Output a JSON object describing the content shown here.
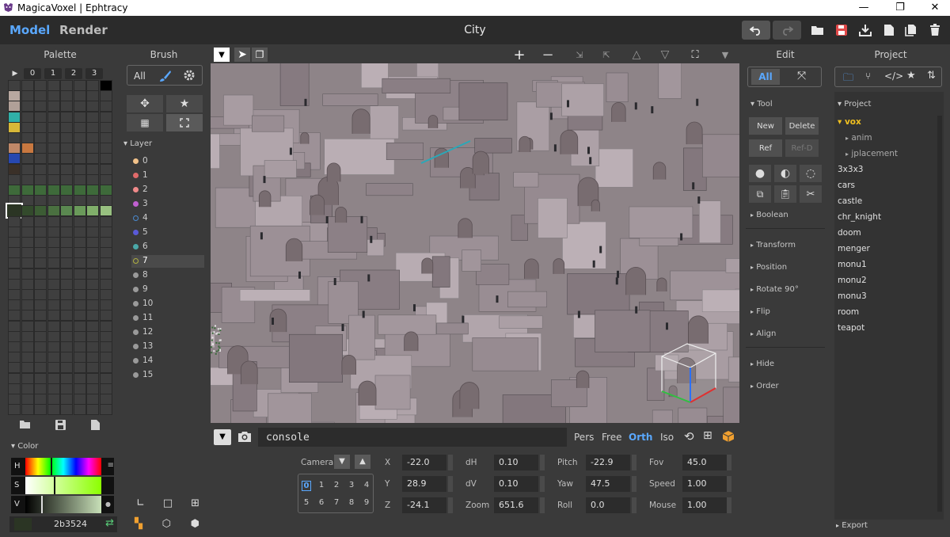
{
  "window": {
    "title": "MagicaVoxel | Ephtracy",
    "controls": [
      "—",
      "❐",
      "✕"
    ]
  },
  "header": {
    "tabs": [
      {
        "label": "Model"
      },
      {
        "label": "Render"
      }
    ],
    "doc_title": "City"
  },
  "palette": {
    "title": "Palette",
    "tabs": [
      "0",
      "1",
      "2",
      "3"
    ],
    "play_symbol": "▶",
    "accent": "#ffffff"
  },
  "color": {
    "title": "Color",
    "h_label": "H",
    "s_label": "S",
    "v_label": "V",
    "hex": "2b3524",
    "swatch_color": "#2b3524"
  },
  "brush": {
    "title": "Brush",
    "all_label": "All",
    "layer_title": "Layer",
    "layers": [
      {
        "label": "0",
        "color": "#f2c28a"
      },
      {
        "label": "1",
        "color": "#e06a6a"
      },
      {
        "label": "2",
        "color": "#f08a8a"
      },
      {
        "label": "3",
        "color": "#c060d0"
      },
      {
        "label": "4",
        "color": "#4a8ad0"
      },
      {
        "label": "5",
        "color": "#5a5ad8"
      },
      {
        "label": "6",
        "color": "#4aa8a8"
      },
      {
        "label": "7",
        "color": "#b0b040"
      },
      {
        "label": "8",
        "color": "#9a9a9a"
      },
      {
        "label": "9",
        "color": "#9a9a9a"
      },
      {
        "label": "10",
        "color": "#9a9a9a"
      },
      {
        "label": "11",
        "color": "#9a9a9a"
      },
      {
        "label": "12",
        "color": "#9a9a9a"
      },
      {
        "label": "13",
        "color": "#9a9a9a"
      },
      {
        "label": "14",
        "color": "#9a9a9a"
      },
      {
        "label": "15",
        "color": "#9a9a9a"
      }
    ]
  },
  "console": {
    "value": "console",
    "modes": [
      "Pers",
      "Free",
      "Orth",
      "Iso"
    ],
    "active_mode": "Orth"
  },
  "camera": {
    "label": "Camera",
    "slots": [
      "0",
      "1",
      "2",
      "3",
      "4",
      "5",
      "6",
      "7",
      "8",
      "9"
    ],
    "fields": {
      "x_label": "X",
      "x": "-22.0",
      "y_label": "Y",
      "y": "28.9",
      "z_label": "Z",
      "z": "-24.1",
      "dh_label": "dH",
      "dh": "0.10",
      "dv_label": "dV",
      "dv": "0.10",
      "zoom_label": "Zoom",
      "zoom": "651.6",
      "pitch_label": "Pitch",
      "pitch": "-22.9",
      "yaw_label": "Yaw",
      "yaw": "47.5",
      "roll_label": "Roll",
      "roll": "0.0",
      "fov_label": "Fov",
      "fov": "45.0",
      "speed_label": "Speed",
      "speed": "1.00",
      "mouse_label": "Mouse",
      "mouse": "1.00"
    }
  },
  "edit": {
    "title": "Edit",
    "all_label": "All",
    "tool_label": "Tool",
    "buttons": {
      "new": "New",
      "delete": "Delete",
      "ref": "Ref",
      "refd": "Ref-D"
    },
    "sections": [
      "Boolean",
      "Transform",
      "Position",
      "Rotate 90°",
      "Flip",
      "Align",
      "Hide",
      "Order"
    ]
  },
  "project": {
    "title": "Project",
    "tree_label": "Project",
    "folder": "vox",
    "subfolders": [
      "anim",
      "jplacement"
    ],
    "items": [
      "3x3x3",
      "cars",
      "castle",
      "chr_knight",
      "doom",
      "menger",
      "monu1",
      "monu2",
      "monu3",
      "room",
      "teapot"
    ],
    "export_label": "Export"
  },
  "colors": {
    "accent": "#5aa8ff",
    "folder_highlight": "#f0c020",
    "viewport_bg": "#8e8488"
  }
}
